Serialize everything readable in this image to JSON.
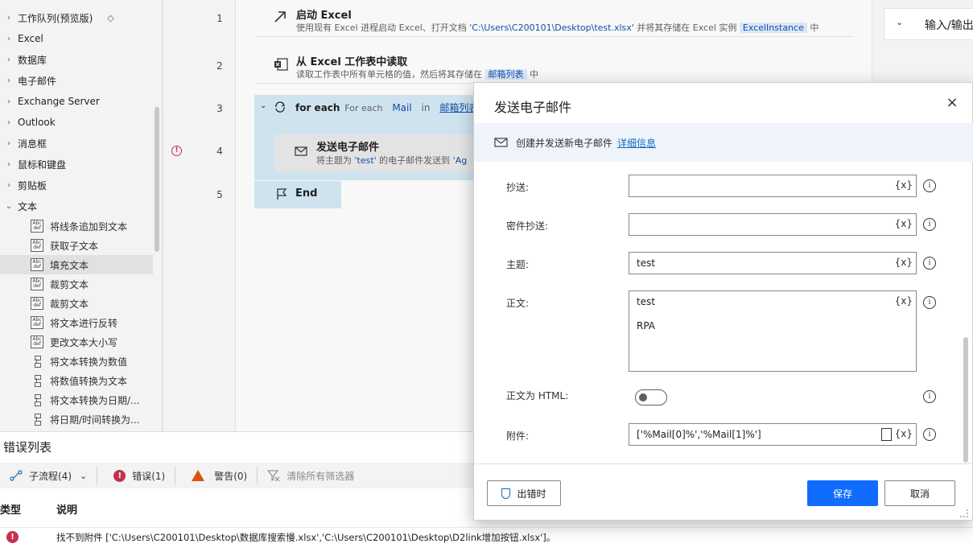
{
  "left_panel": {
    "categories": [
      {
        "label": "工作队列(预览版)",
        "badge": "◇",
        "expanded": false
      },
      {
        "label": "Excel",
        "expanded": false
      },
      {
        "label": "数据库",
        "expanded": false
      },
      {
        "label": "电子邮件",
        "expanded": false
      },
      {
        "label": "Exchange Server",
        "expanded": false
      },
      {
        "label": "Outlook",
        "expanded": false
      },
      {
        "label": "消息框",
        "expanded": false
      },
      {
        "label": "鼠标和键盘",
        "expanded": false
      },
      {
        "label": "剪贴板",
        "expanded": false
      },
      {
        "label": "文本",
        "expanded": true
      }
    ],
    "text_items": [
      {
        "label": "将线条追加到文本",
        "icon": "abc"
      },
      {
        "label": "获取子文本",
        "icon": "abc"
      },
      {
        "label": "填充文本",
        "icon": "abc",
        "selected": true
      },
      {
        "label": "裁剪文本",
        "icon": "abc"
      },
      {
        "label": "裁剪文本",
        "icon": "abc"
      },
      {
        "label": "将文本进行反转",
        "icon": "abc"
      },
      {
        "label": "更改文本大小写",
        "icon": "abc"
      },
      {
        "label": "将文本转换为数值",
        "icon": "convert"
      },
      {
        "label": "将数值转换为文本",
        "icon": "convert"
      },
      {
        "label": "将文本转换为日期/...",
        "icon": "convert"
      },
      {
        "label": "将日期/时间转换为...",
        "icon": "convert"
      }
    ],
    "abc_icon_text": "Abc\ndef"
  },
  "flow": {
    "lines": [
      "1",
      "2",
      "3",
      "4",
      "5"
    ],
    "actions": {
      "launch_excel": {
        "title": "启动 Excel",
        "desc_prefix": "使用现有 Excel 进程启动 Excel、打开文档 ",
        "desc_path": "'C:\\Users\\C200101\\Desktop\\test.xlsx'",
        "desc_mid": " 并将其存储在 Excel 实例 ",
        "desc_var": "ExcelInstance",
        "desc_suffix": " 中"
      },
      "read_excel": {
        "title": "从 Excel 工作表中读取",
        "desc_prefix": "读取工作表中所有单元格的值，然后将其存储在 ",
        "desc_var": "邮箱列表",
        "desc_suffix": " 中"
      },
      "foreach": {
        "keyword": "for each",
        "label": "For each",
        "var": "Mail",
        "in": "in",
        "list": "邮箱列表"
      },
      "send_mail": {
        "title": "发送电子邮件",
        "desc_prefix": "将主题为 ",
        "desc_subject": "'test'",
        "desc_mid": " 的电子邮件发送到 ",
        "desc_to": "'Ag"
      },
      "end": {
        "label": "End"
      }
    },
    "error_marker": "!"
  },
  "right_panel": {
    "title": "输入/输出"
  },
  "error_list": {
    "title": "错误列表",
    "toolbar": {
      "subflow": "子流程(4)",
      "errors": "错误(1)",
      "warnings": "警告(0)",
      "clear_filters": "清除所有筛选器"
    },
    "columns": {
      "type": "类型",
      "description": "说明"
    },
    "rows": [
      {
        "type_icon": "!",
        "description": "找不到附件 ['C:\\Users\\C200101\\Desktop\\数据库搜索慢.xlsx','C:\\Users\\C200101\\Desktop\\D2link增加按钮.xlsx']。"
      }
    ]
  },
  "dialog": {
    "title": "发送电子邮件",
    "close": "×",
    "info_text": "创建并发送新电子邮件",
    "info_link": "详细信息",
    "fields": {
      "cc": {
        "label": "抄送:",
        "value": ""
      },
      "bcc": {
        "label": "密件抄送:",
        "value": ""
      },
      "subject": {
        "label": "主题:",
        "value": "test"
      },
      "body": {
        "label": "正文:",
        "value_line1": "test",
        "value_line2": "RPA"
      },
      "body_html": {
        "label": "正文为 HTML:",
        "checked": false
      },
      "attachments": {
        "label": "附件:",
        "value": "['%Mail[0]%','%Mail[1]%']"
      }
    },
    "var_button": "{x}",
    "info_icon": "i",
    "buttons": {
      "on_error": "出错时",
      "save": "保存",
      "cancel": "取消"
    }
  },
  "colors": {
    "accent": "#0f6cfe",
    "error": "#c4314b",
    "warning": "#d9540b",
    "foreach_bg": "#cfe3ef",
    "info_bar": "#eff4fb"
  }
}
